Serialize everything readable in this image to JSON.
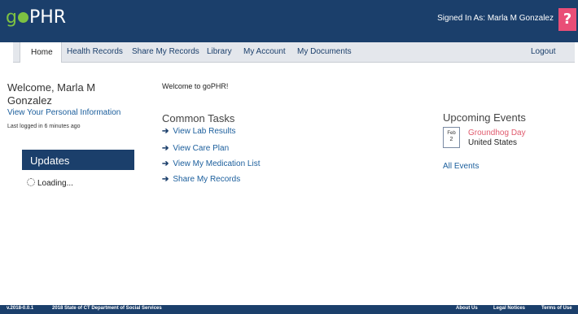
{
  "header": {
    "logo_prefix": "g",
    "logo_text": "PHR",
    "signed_in": "Signed In As:  Marla M Gonzalez",
    "help_label": "?"
  },
  "nav": {
    "items": [
      "Home",
      "Health Records",
      "Share My Records",
      "Library",
      "My Account",
      "My Documents"
    ],
    "logout": "Logout"
  },
  "sidebar": {
    "welcome": "Welcome, Marla M Gonzalez",
    "view_info": "View Your Personal Information",
    "last_login": "Last logged in 6 minutes ago",
    "updates_title": "Updates",
    "loading": "Loading..."
  },
  "main": {
    "welcome_text": "Welcome to goPHR!",
    "common_tasks_title": "Common Tasks",
    "tasks": [
      "View Lab Results",
      "View Care Plan",
      "View My Medication List",
      "Share My Records"
    ]
  },
  "events": {
    "title": "Upcoming Events",
    "items": [
      {
        "month": "Feb",
        "day": "2",
        "name": "Groundhog Day",
        "location": "United States"
      }
    ],
    "all_events": "All Events"
  },
  "footer": {
    "version": "v.2018-0.0.1",
    "copyright": "2018 State of CT Department of Social Services",
    "links": [
      "About Us",
      "Legal Notices",
      "Terms of Use"
    ]
  },
  "colors": {
    "header_bg": "#1b3f6b",
    "brand_green": "#7dc242",
    "help_pink": "#e94e77",
    "event_red": "#e05b6e",
    "link_blue": "#1b5e9c"
  }
}
